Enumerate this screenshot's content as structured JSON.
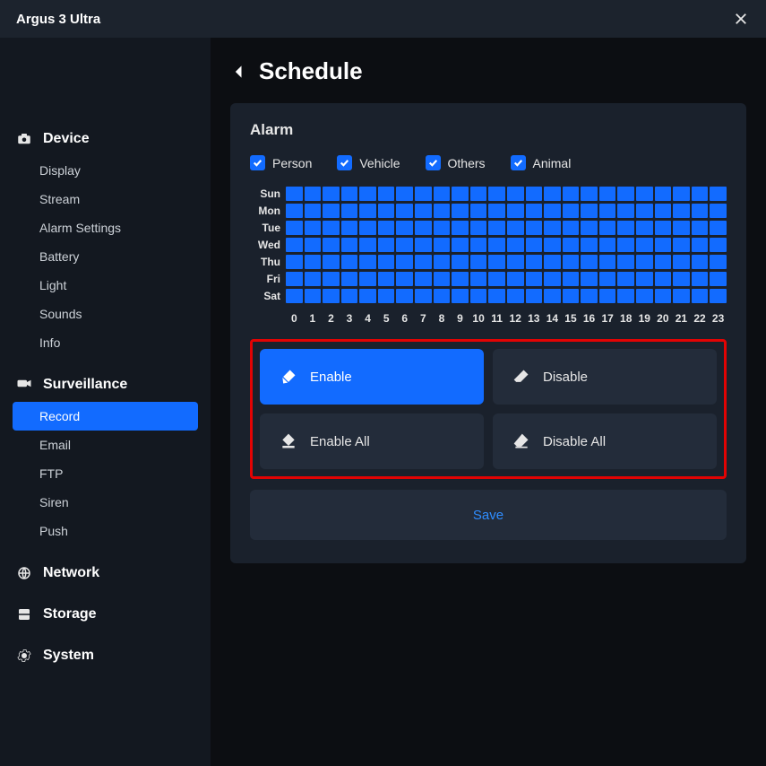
{
  "window": {
    "title": "Argus 3 Ultra"
  },
  "sidebar": {
    "sections": [
      {
        "label": "Device",
        "items": [
          "Display",
          "Stream",
          "Alarm Settings",
          "Battery",
          "Light",
          "Sounds",
          "Info"
        ]
      },
      {
        "label": "Surveillance",
        "items": [
          "Record",
          "Email",
          "FTP",
          "Siren",
          "Push"
        ],
        "active_index": 0
      },
      {
        "label": "Network",
        "items": []
      },
      {
        "label": "Storage",
        "items": []
      },
      {
        "label": "System",
        "items": []
      }
    ]
  },
  "page": {
    "title": "Schedule",
    "panel_title": "Alarm"
  },
  "filters": [
    {
      "label": "Person",
      "checked": true
    },
    {
      "label": "Vehicle",
      "checked": true
    },
    {
      "label": "Others",
      "checked": true
    },
    {
      "label": "Animal",
      "checked": true
    }
  ],
  "schedule": {
    "days": [
      "Sun",
      "Mon",
      "Tue",
      "Wed",
      "Thu",
      "Fri",
      "Sat"
    ],
    "hours": [
      "0",
      "1",
      "2",
      "3",
      "4",
      "5",
      "6",
      "7",
      "8",
      "9",
      "10",
      "11",
      "12",
      "13",
      "14",
      "15",
      "16",
      "17",
      "18",
      "19",
      "20",
      "21",
      "22",
      "23"
    ]
  },
  "actions": {
    "enable": "Enable",
    "disable": "Disable",
    "enable_all": "Enable All",
    "disable_all": "Disable All",
    "save": "Save"
  },
  "colors": {
    "accent": "#126bff",
    "highlight_border": "#e20303",
    "link": "#2f8dff"
  }
}
